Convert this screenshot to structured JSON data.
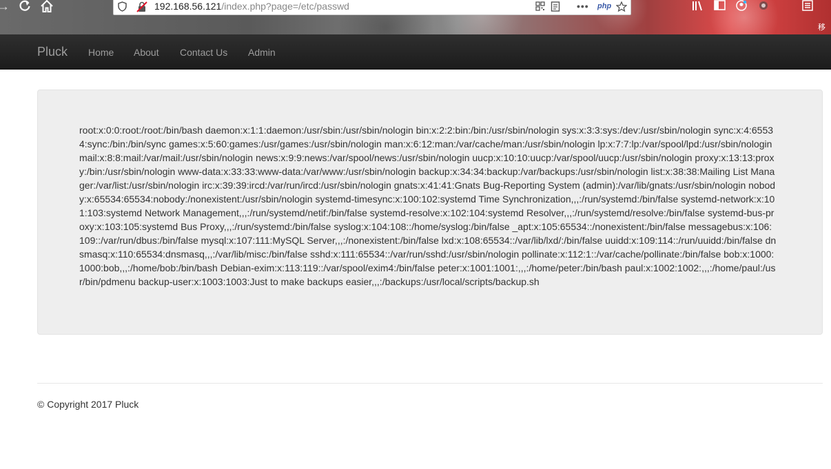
{
  "browser": {
    "url_host": "192.168.56.121",
    "url_path": "/index.php?page=/etc/passwd",
    "php_badge": "php",
    "icons": [
      "back-arrow-icon",
      "reload-icon",
      "home-icon",
      "shield-icon",
      "insecure-lock-icon",
      "qr-code-icon",
      "reader-view-icon",
      "more-options-icon",
      "bookmark-star-icon",
      "library-icon",
      "sidebar-icon",
      "account-icon",
      "extension-icon",
      "menu-icon"
    ],
    "corner_text": "移动"
  },
  "navbar": {
    "brand": "Pluck",
    "links": [
      "Home",
      "About",
      "Contact Us",
      "Admin"
    ]
  },
  "content": {
    "text": "root:x:0:0:root:/root:/bin/bash daemon:x:1:1:daemon:/usr/sbin:/usr/sbin/nologin bin:x:2:2:bin:/bin:/usr/sbin/nologin sys:x:3:3:sys:/dev:/usr/sbin/nologin sync:x:4:65534:sync:/bin:/bin/sync games:x:5:60:games:/usr/games:/usr/sbin/nologin man:x:6:12:man:/var/cache/man:/usr/sbin/nologin lp:x:7:7:lp:/var/spool/lpd:/usr/sbin/nologin mail:x:8:8:mail:/var/mail:/usr/sbin/nologin news:x:9:9:news:/var/spool/news:/usr/sbin/nologin uucp:x:10:10:uucp:/var/spool/uucp:/usr/sbin/nologin proxy:x:13:13:proxy:/bin:/usr/sbin/nologin www-data:x:33:33:www-data:/var/www:/usr/sbin/nologin backup:x:34:34:backup:/var/backups:/usr/sbin/nologin list:x:38:38:Mailing List Manager:/var/list:/usr/sbin/nologin irc:x:39:39:ircd:/var/run/ircd:/usr/sbin/nologin gnats:x:41:41:Gnats Bug-Reporting System (admin):/var/lib/gnats:/usr/sbin/nologin nobody:x:65534:65534:nobody:/nonexistent:/usr/sbin/nologin systemd-timesync:x:100:102:systemd Time Synchronization,,,:/run/systemd:/bin/false systemd-network:x:101:103:systemd Network Management,,,:/run/systemd/netif:/bin/false systemd-resolve:x:102:104:systemd Resolver,,,:/run/systemd/resolve:/bin/false systemd-bus-proxy:x:103:105:systemd Bus Proxy,,,:/run/systemd:/bin/false syslog:x:104:108::/home/syslog:/bin/false _apt:x:105:65534::/nonexistent:/bin/false messagebus:x:106:109::/var/run/dbus:/bin/false mysql:x:107:111:MySQL Server,,,:/nonexistent:/bin/false lxd:x:108:65534::/var/lib/lxd/:/bin/false uuidd:x:109:114::/run/uuidd:/bin/false dnsmasq:x:110:65534:dnsmasq,,,:/var/lib/misc:/bin/false sshd:x:111:65534::/var/run/sshd:/usr/sbin/nologin pollinate:x:112:1::/var/cache/pollinate:/bin/false bob:x:1000:1000:bob,,,:/home/bob:/bin/bash Debian-exim:x:113:119::/var/spool/exim4:/bin/false peter:x:1001:1001:,,,:/home/peter:/bin/bash paul:x:1002:1002:,,,:/home/paul:/usr/bin/pdmenu backup-user:x:1003:1003:Just to make backups easier,,,:/backups:/usr/local/scripts/backup.sh"
  },
  "footer": {
    "copyright": "© Copyright 2017 Pluck"
  }
}
